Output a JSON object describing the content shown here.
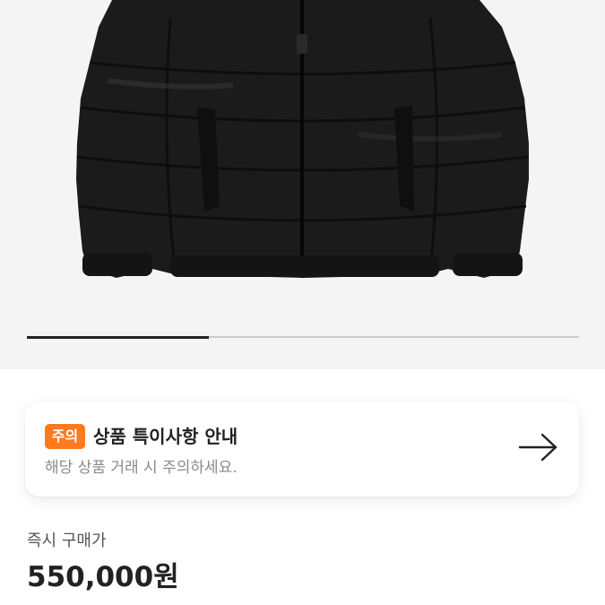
{
  "product_image": {
    "alt": "black puffer jacket"
  },
  "image_carousel": {
    "progress": 0.33
  },
  "notice": {
    "badge": "주의",
    "title": "상품 특이사항 안내",
    "subtitle": "해당 상품 거래 시 주의하세요.",
    "icon": "arrow-right-icon",
    "badge_color": "#ff7a1f"
  },
  "price": {
    "label": "즉시 구매가",
    "value": "550,000원"
  }
}
